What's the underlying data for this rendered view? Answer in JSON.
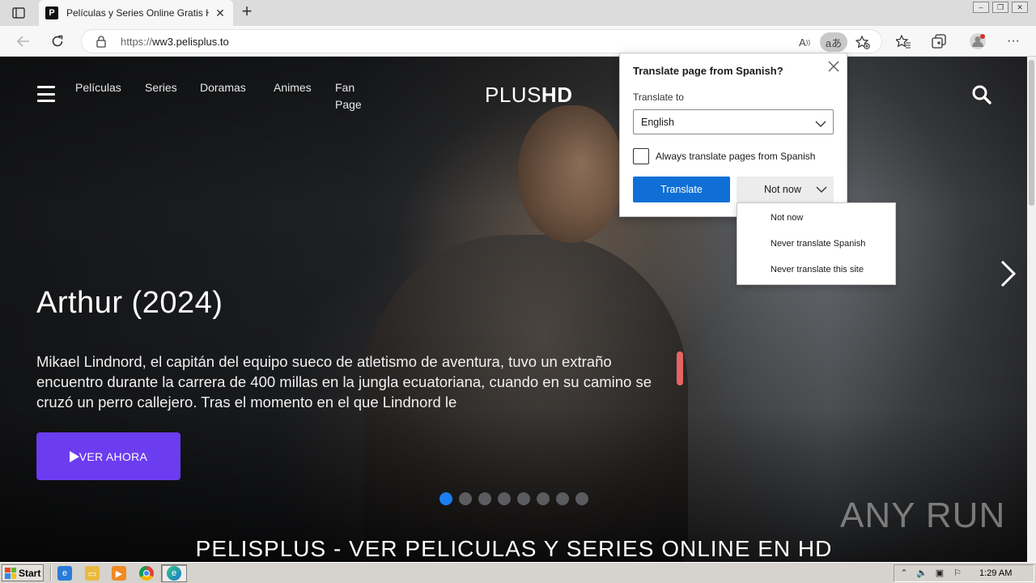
{
  "browser": {
    "tab": {
      "favicon_letter": "P",
      "title": "Películas y Series Online Gratis HD"
    },
    "address": {
      "url_prefix": "https://",
      "url_host": "ww3.pelisplus.to"
    }
  },
  "site": {
    "nav_links": [
      "Películas",
      "Series",
      "Doramas",
      "Animes",
      "Fan",
      "Page"
    ],
    "logo_plus": "PLUS",
    "logo_hd": "HD",
    "hero": {
      "title": "Arthur (2024)",
      "description": "Mikael Lindnord, el capitán del equipo sueco de atletismo de aventura, tuvo un extraño encuentro durante la carrera de 400 millas en la jungla ecuatoriana, cuando en su camino se cruzó un perro callejero. Tras el momento en el que Lindnord le",
      "watch_label": "VER AHORA",
      "slide_count": 8,
      "active_slide": 1
    },
    "section_heading": "PELISPLUS - VER PELICULAS Y SERIES ONLINE EN HD",
    "watermark": "ANY RUN"
  },
  "translate_popup": {
    "title": "Translate page from Spanish?",
    "translate_to_label": "Translate to",
    "language": "English",
    "always_label": "Always translate pages from Spanish",
    "always_checked": false,
    "translate_button": "Translate",
    "not_now_button": "Not now",
    "menu": [
      "Not now",
      "Never translate Spanish",
      "Never translate this site"
    ]
  },
  "taskbar": {
    "start_label": "Start",
    "clock": "1:29 AM"
  },
  "colors": {
    "accent_blue": "#0f6fd6",
    "watch_button": "#6c3cf0",
    "active_dot": "#1b7ef2"
  }
}
